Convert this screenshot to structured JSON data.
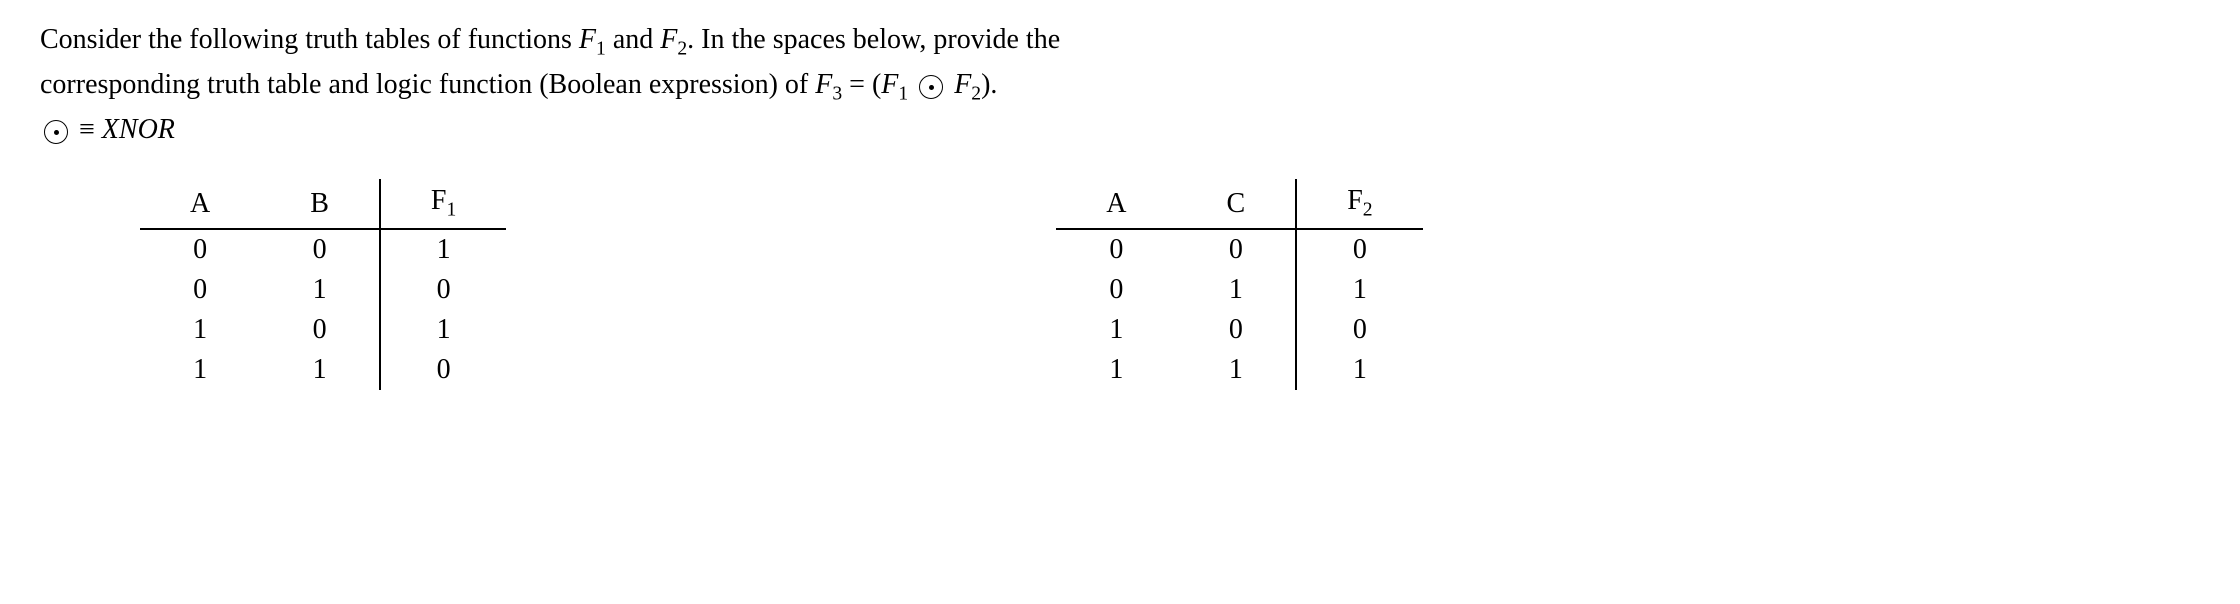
{
  "problem": {
    "line1_part1": "Consider the following truth tables of functions ",
    "f1": "F",
    "f1_sub": "1",
    "line1_part2": " and ",
    "f2": "F",
    "f2_sub": "2",
    "line1_part3": ". In the spaces below, provide the",
    "line2_part1": "corresponding truth table and logic function (Boolean expression) of ",
    "f3": "F",
    "f3_sub": "3",
    "line2_part2": " =  (",
    "f1b": "F",
    "f1b_sub": "1",
    "line2_part3": " ",
    "line2_part4": " ",
    "f2b": "F",
    "f2b_sub": "2",
    "line2_part5": ").",
    "line3_part1": " ≡ ",
    "line3_part2": "XNOR"
  },
  "table1": {
    "headers": {
      "col1": "A",
      "col2": "B",
      "col3": "F",
      "col3_sub": "1"
    },
    "rows": [
      {
        "c1": "0",
        "c2": "0",
        "c3": "1"
      },
      {
        "c1": "0",
        "c2": "1",
        "c3": "0"
      },
      {
        "c1": "1",
        "c2": "0",
        "c3": "1"
      },
      {
        "c1": "1",
        "c2": "1",
        "c3": "0"
      }
    ]
  },
  "table2": {
    "headers": {
      "col1": "A",
      "col2": "C",
      "col3": "F",
      "col3_sub": "2"
    },
    "rows": [
      {
        "c1": "0",
        "c2": "0",
        "c3": "0"
      },
      {
        "c1": "0",
        "c2": "1",
        "c3": "1"
      },
      {
        "c1": "1",
        "c2": "0",
        "c3": "0"
      },
      {
        "c1": "1",
        "c2": "1",
        "c3": "1"
      }
    ]
  }
}
